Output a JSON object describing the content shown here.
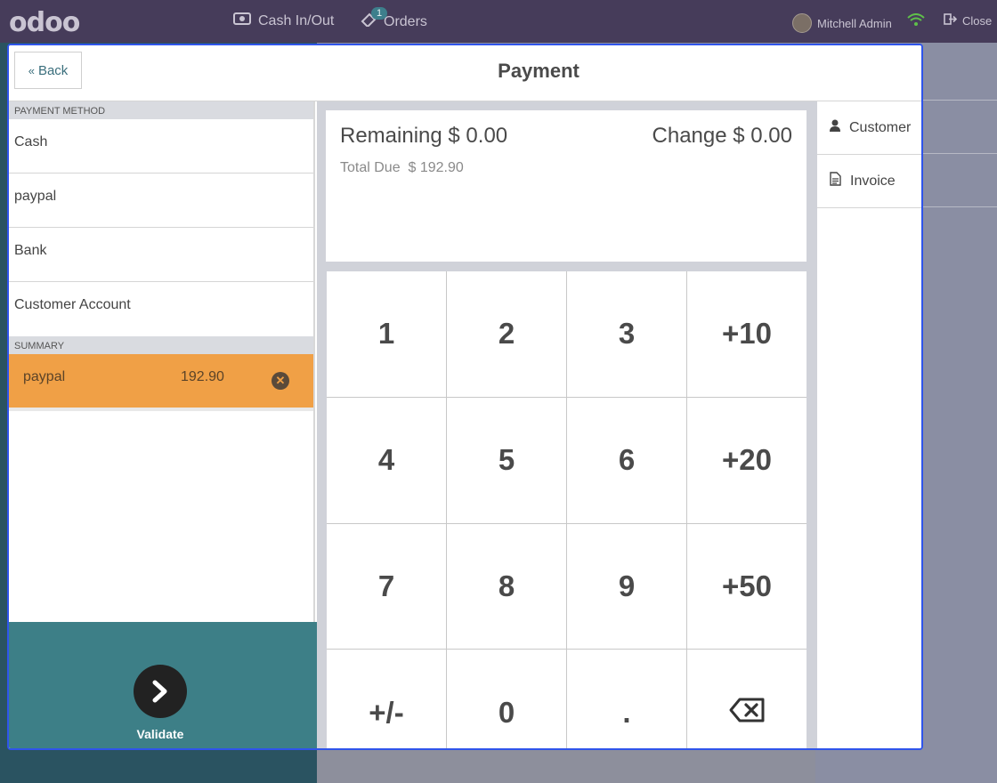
{
  "topbar": {
    "logo": "odoo",
    "cash_in_out": "Cash In/Out",
    "orders": "Orders",
    "orders_badge": "1",
    "user": "Mitchell Admin",
    "close": "Close"
  },
  "header": {
    "back_label": "Back",
    "title": "Payment"
  },
  "left": {
    "payment_method_label": "PAYMENT METHOD",
    "methods": [
      "Cash",
      "paypal",
      "Bank",
      "Customer Account"
    ],
    "summary_label": "SUMMARY",
    "summary_line": {
      "name": "paypal",
      "amount": "192.90"
    },
    "validate_label": "Validate"
  },
  "totals": {
    "remaining_label": "Remaining",
    "remaining_value": "$ 0.00",
    "change_label": "Change",
    "change_value": "$ 0.00",
    "total_due_label": "Total Due",
    "total_due_value": "$ 192.90"
  },
  "numpad": [
    "1",
    "2",
    "3",
    "+10",
    "4",
    "5",
    "6",
    "+20",
    "7",
    "8",
    "9",
    "+50",
    "+/-",
    "0",
    ".",
    "⌫"
  ],
  "right": {
    "customer": "Customer",
    "invoice": "Invoice"
  },
  "colors": {
    "topbar": "#463c5a",
    "accent": "#3d7f87",
    "selected_line": "#f0a046",
    "focus_border": "#2f54eb"
  }
}
